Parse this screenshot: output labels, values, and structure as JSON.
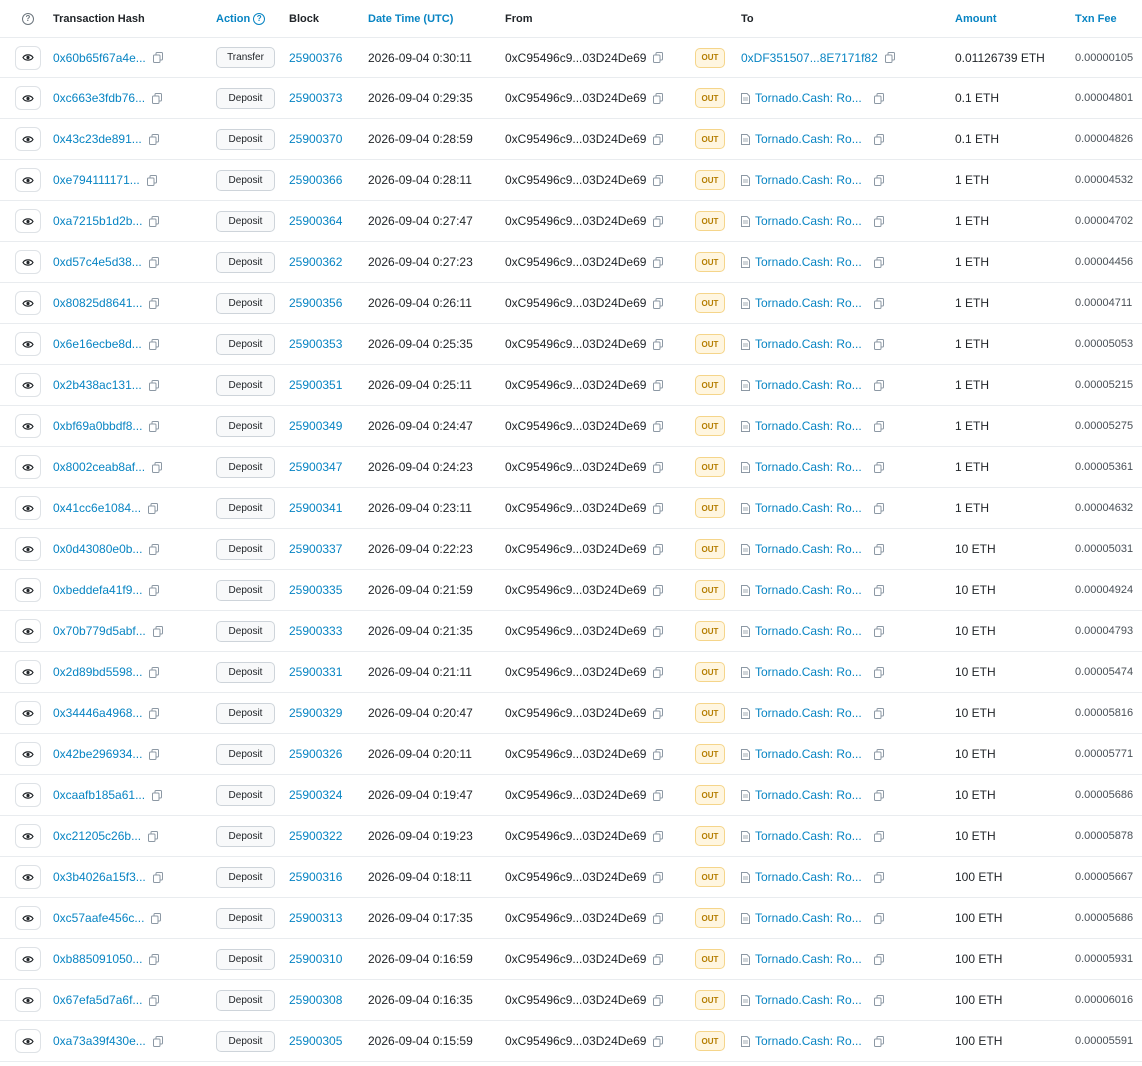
{
  "headers": {
    "hash": "Transaction Hash",
    "action": "Action",
    "block": "Block",
    "time": "Date Time (UTC)",
    "from": "From",
    "to": "To",
    "amount": "Amount",
    "fee": "Txn Fee"
  },
  "colors": {
    "link": "#0784c3",
    "out_badge_bg": "#fff6e0",
    "out_badge_text": "#b47d00"
  },
  "rows": [
    {
      "hash": "0x60b65f67a4e...",
      "action": "Transfer",
      "block": "25900376",
      "time": "2026-09-04 0:30:11",
      "from": "0xC95496c9...03D24De69",
      "dir": "OUT",
      "to": "0xDF351507...8E7171f82",
      "to_contract": false,
      "amount": "0.01126739 ETH",
      "fee": "0.00000105"
    },
    {
      "hash": "0xc663e3fdb76...",
      "action": "Deposit",
      "block": "25900373",
      "time": "2026-09-04 0:29:35",
      "from": "0xC95496c9...03D24De69",
      "dir": "OUT",
      "to": "Tornado.Cash: Ro...",
      "to_contract": true,
      "amount": "0.1 ETH",
      "fee": "0.00004801"
    },
    {
      "hash": "0x43c23de891...",
      "action": "Deposit",
      "block": "25900370",
      "time": "2026-09-04 0:28:59",
      "from": "0xC95496c9...03D24De69",
      "dir": "OUT",
      "to": "Tornado.Cash: Ro...",
      "to_contract": true,
      "amount": "0.1 ETH",
      "fee": "0.00004826"
    },
    {
      "hash": "0xe794111171...",
      "action": "Deposit",
      "block": "25900366",
      "time": "2026-09-04 0:28:11",
      "from": "0xC95496c9...03D24De69",
      "dir": "OUT",
      "to": "Tornado.Cash: Ro...",
      "to_contract": true,
      "amount": "1 ETH",
      "fee": "0.00004532"
    },
    {
      "hash": "0xa7215b1d2b...",
      "action": "Deposit",
      "block": "25900364",
      "time": "2026-09-04 0:27:47",
      "from": "0xC95496c9...03D24De69",
      "dir": "OUT",
      "to": "Tornado.Cash: Ro...",
      "to_contract": true,
      "amount": "1 ETH",
      "fee": "0.00004702"
    },
    {
      "hash": "0xd57c4e5d38...",
      "action": "Deposit",
      "block": "25900362",
      "time": "2026-09-04 0:27:23",
      "from": "0xC95496c9...03D24De69",
      "dir": "OUT",
      "to": "Tornado.Cash: Ro...",
      "to_contract": true,
      "amount": "1 ETH",
      "fee": "0.00004456"
    },
    {
      "hash": "0x80825d8641...",
      "action": "Deposit",
      "block": "25900356",
      "time": "2026-09-04 0:26:11",
      "from": "0xC95496c9...03D24De69",
      "dir": "OUT",
      "to": "Tornado.Cash: Ro...",
      "to_contract": true,
      "amount": "1 ETH",
      "fee": "0.00004711"
    },
    {
      "hash": "0x6e16ecbe8d...",
      "action": "Deposit",
      "block": "25900353",
      "time": "2026-09-04 0:25:35",
      "from": "0xC95496c9...03D24De69",
      "dir": "OUT",
      "to": "Tornado.Cash: Ro...",
      "to_contract": true,
      "amount": "1 ETH",
      "fee": "0.00005053"
    },
    {
      "hash": "0x2b438ac131...",
      "action": "Deposit",
      "block": "25900351",
      "time": "2026-09-04 0:25:11",
      "from": "0xC95496c9...03D24De69",
      "dir": "OUT",
      "to": "Tornado.Cash: Ro...",
      "to_contract": true,
      "amount": "1 ETH",
      "fee": "0.00005215"
    },
    {
      "hash": "0xbf69a0bbdf8...",
      "action": "Deposit",
      "block": "25900349",
      "time": "2026-09-04 0:24:47",
      "from": "0xC95496c9...03D24De69",
      "dir": "OUT",
      "to": "Tornado.Cash: Ro...",
      "to_contract": true,
      "amount": "1 ETH",
      "fee": "0.00005275"
    },
    {
      "hash": "0x8002ceab8af...",
      "action": "Deposit",
      "block": "25900347",
      "time": "2026-09-04 0:24:23",
      "from": "0xC95496c9...03D24De69",
      "dir": "OUT",
      "to": "Tornado.Cash: Ro...",
      "to_contract": true,
      "amount": "1 ETH",
      "fee": "0.00005361"
    },
    {
      "hash": "0x41cc6e1084...",
      "action": "Deposit",
      "block": "25900341",
      "time": "2026-09-04 0:23:11",
      "from": "0xC95496c9...03D24De69",
      "dir": "OUT",
      "to": "Tornado.Cash: Ro...",
      "to_contract": true,
      "amount": "1 ETH",
      "fee": "0.00004632"
    },
    {
      "hash": "0x0d43080e0b...",
      "action": "Deposit",
      "block": "25900337",
      "time": "2026-09-04 0:22:23",
      "from": "0xC95496c9...03D24De69",
      "dir": "OUT",
      "to": "Tornado.Cash: Ro...",
      "to_contract": true,
      "amount": "10 ETH",
      "fee": "0.00005031"
    },
    {
      "hash": "0xbeddefa41f9...",
      "action": "Deposit",
      "block": "25900335",
      "time": "2026-09-04 0:21:59",
      "from": "0xC95496c9...03D24De69",
      "dir": "OUT",
      "to": "Tornado.Cash: Ro...",
      "to_contract": true,
      "amount": "10 ETH",
      "fee": "0.00004924"
    },
    {
      "hash": "0x70b779d5abf...",
      "action": "Deposit",
      "block": "25900333",
      "time": "2026-09-04 0:21:35",
      "from": "0xC95496c9...03D24De69",
      "dir": "OUT",
      "to": "Tornado.Cash: Ro...",
      "to_contract": true,
      "amount": "10 ETH",
      "fee": "0.00004793"
    },
    {
      "hash": "0x2d89bd5598...",
      "action": "Deposit",
      "block": "25900331",
      "time": "2026-09-04 0:21:11",
      "from": "0xC95496c9...03D24De69",
      "dir": "OUT",
      "to": "Tornado.Cash: Ro...",
      "to_contract": true,
      "amount": "10 ETH",
      "fee": "0.00005474"
    },
    {
      "hash": "0x34446a4968...",
      "action": "Deposit",
      "block": "25900329",
      "time": "2026-09-04 0:20:47",
      "from": "0xC95496c9...03D24De69",
      "dir": "OUT",
      "to": "Tornado.Cash: Ro...",
      "to_contract": true,
      "amount": "10 ETH",
      "fee": "0.00005816"
    },
    {
      "hash": "0x42be296934...",
      "action": "Deposit",
      "block": "25900326",
      "time": "2026-09-04 0:20:11",
      "from": "0xC95496c9...03D24De69",
      "dir": "OUT",
      "to": "Tornado.Cash: Ro...",
      "to_contract": true,
      "amount": "10 ETH",
      "fee": "0.00005771"
    },
    {
      "hash": "0xcaafb185a61...",
      "action": "Deposit",
      "block": "25900324",
      "time": "2026-09-04 0:19:47",
      "from": "0xC95496c9...03D24De69",
      "dir": "OUT",
      "to": "Tornado.Cash: Ro...",
      "to_contract": true,
      "amount": "10 ETH",
      "fee": "0.00005686"
    },
    {
      "hash": "0xc21205c26b...",
      "action": "Deposit",
      "block": "25900322",
      "time": "2026-09-04 0:19:23",
      "from": "0xC95496c9...03D24De69",
      "dir": "OUT",
      "to": "Tornado.Cash: Ro...",
      "to_contract": true,
      "amount": "10 ETH",
      "fee": "0.00005878"
    },
    {
      "hash": "0x3b4026a15f3...",
      "action": "Deposit",
      "block": "25900316",
      "time": "2026-09-04 0:18:11",
      "from": "0xC95496c9...03D24De69",
      "dir": "OUT",
      "to": "Tornado.Cash: Ro...",
      "to_contract": true,
      "amount": "100 ETH",
      "fee": "0.00005667"
    },
    {
      "hash": "0xc57aafe456c...",
      "action": "Deposit",
      "block": "25900313",
      "time": "2026-09-04 0:17:35",
      "from": "0xC95496c9...03D24De69",
      "dir": "OUT",
      "to": "Tornado.Cash: Ro...",
      "to_contract": true,
      "amount": "100 ETH",
      "fee": "0.00005686"
    },
    {
      "hash": "0xb885091050...",
      "action": "Deposit",
      "block": "25900310",
      "time": "2026-09-04 0:16:59",
      "from": "0xC95496c9...03D24De69",
      "dir": "OUT",
      "to": "Tornado.Cash: Ro...",
      "to_contract": true,
      "amount": "100 ETH",
      "fee": "0.00005931"
    },
    {
      "hash": "0x67efa5d7a6f...",
      "action": "Deposit",
      "block": "25900308",
      "time": "2026-09-04 0:16:35",
      "from": "0xC95496c9...03D24De69",
      "dir": "OUT",
      "to": "Tornado.Cash: Ro...",
      "to_contract": true,
      "amount": "100 ETH",
      "fee": "0.00006016"
    },
    {
      "hash": "0xa73a39f430e...",
      "action": "Deposit",
      "block": "25900305",
      "time": "2026-09-04 0:15:59",
      "from": "0xC95496c9...03D24De69",
      "dir": "OUT",
      "to": "Tornado.Cash: Ro...",
      "to_contract": true,
      "amount": "100 ETH",
      "fee": "0.00005591"
    }
  ]
}
